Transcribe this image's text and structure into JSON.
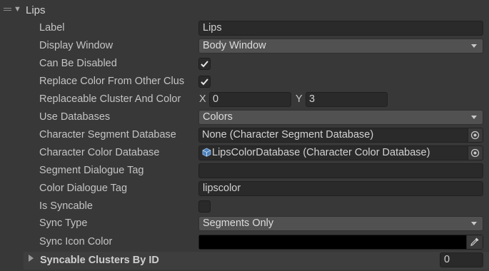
{
  "section": {
    "title": "Lips"
  },
  "fields": {
    "label": {
      "label": "Label",
      "value": "Lips"
    },
    "display_window": {
      "label": "Display Window",
      "value": "Body Window"
    },
    "can_be_disabled": {
      "label": "Can Be Disabled",
      "checked": true
    },
    "replace_color": {
      "label": "Replace Color From Other Clus",
      "checked": true
    },
    "replaceable_cluster": {
      "label": "Replaceable Cluster And Color",
      "x_label": "X",
      "x_value": "0",
      "y_label": "Y",
      "y_value": "3"
    },
    "use_databases": {
      "label": "Use Databases",
      "value": "Colors"
    },
    "segment_database": {
      "label": "Character Segment Database",
      "value": "None (Character Segment Database)"
    },
    "color_database": {
      "label": "Character Color Database",
      "value": "LipsColorDatabase (Character Color Database)"
    },
    "segment_dialogue_tag": {
      "label": "Segment Dialogue Tag",
      "value": ""
    },
    "color_dialogue_tag": {
      "label": "Color Dialogue Tag",
      "value": "lipscolor"
    },
    "is_syncable": {
      "label": "Is Syncable",
      "checked": false
    },
    "sync_type": {
      "label": "Sync Type",
      "value": "Segments Only"
    },
    "sync_icon_color": {
      "label": "Sync Icon Color",
      "color": "#000000"
    }
  },
  "syncable_clusters": {
    "title": "Syncable Clusters By ID",
    "count": "0"
  },
  "icons": {
    "drag": "drag-handle-icon",
    "foldout": "triangle-down-icon",
    "checkmark": "checkmark-icon",
    "object_picker": "object-picker-icon",
    "asset": "scriptable-object-icon",
    "eyedropper": "eyedropper-icon"
  },
  "colors": {
    "background": "#383838",
    "field": "#2a2a2a",
    "dropdown": "#515151"
  }
}
